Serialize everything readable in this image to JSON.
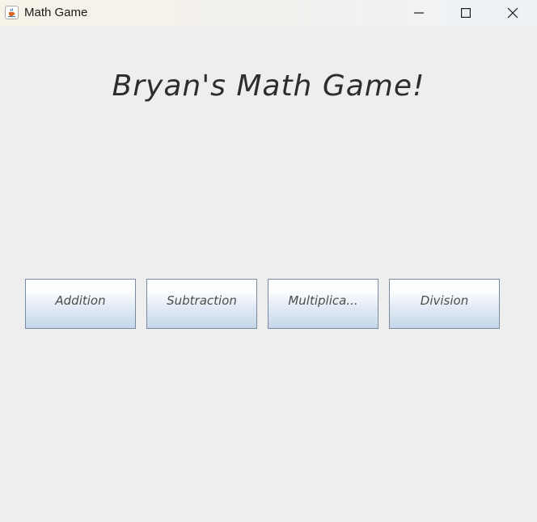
{
  "window": {
    "title": "Math Game",
    "icon": "java-cup-icon",
    "controls": {
      "minimize": "minimize-icon",
      "maximize": "maximize-icon",
      "close": "close-icon"
    }
  },
  "main": {
    "heading": "Bryan's Math Game!",
    "buttons": [
      {
        "label": "Addition"
      },
      {
        "label": "Subtraction"
      },
      {
        "label": "Multiplica..."
      },
      {
        "label": "Division"
      }
    ]
  },
  "colors": {
    "background": "#eeeeee",
    "heading": "#2d2d2d",
    "button_text": "#4d4d4d",
    "button_border": "#7a8a9e"
  }
}
